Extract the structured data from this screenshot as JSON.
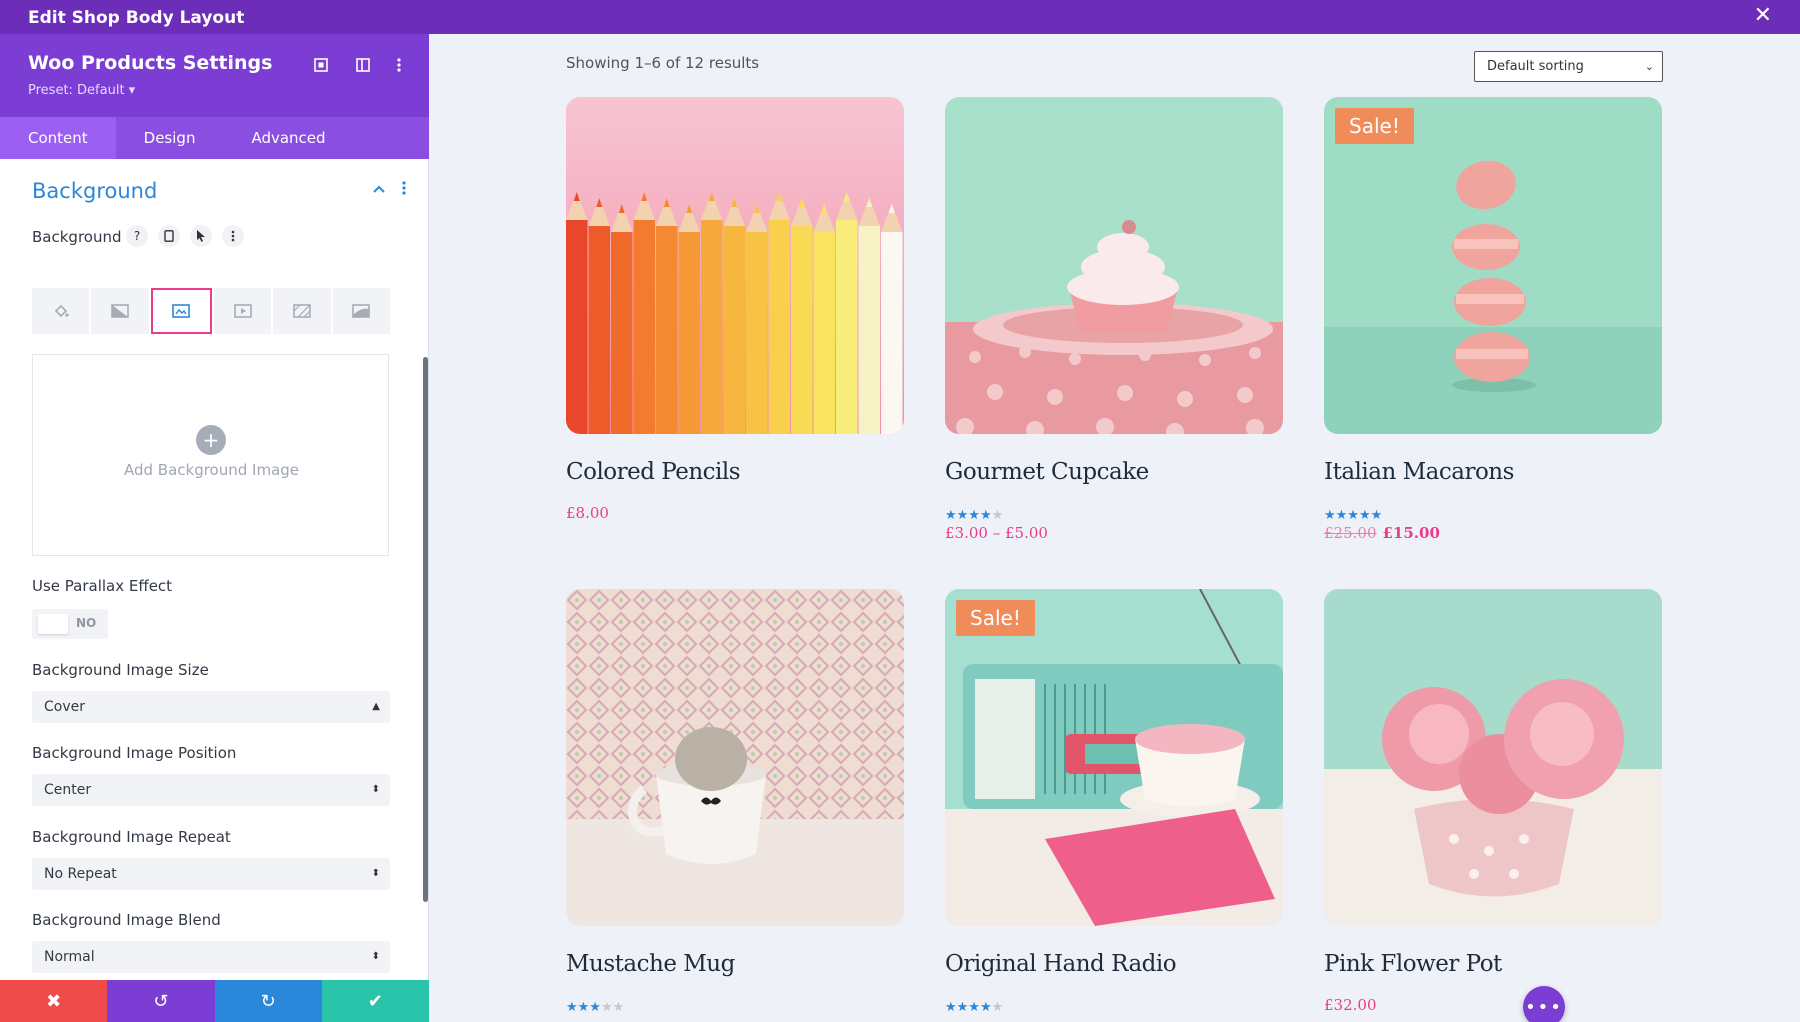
{
  "window": {
    "title": "Edit Shop Body Layout",
    "close_icon": "close-icon"
  },
  "sidebar": {
    "module_title": "Woo Products Settings",
    "preset": "Preset: Default ▾",
    "tabs": [
      {
        "label": "Content",
        "active": true
      },
      {
        "label": "Design",
        "active": false
      },
      {
        "label": "Advanced",
        "active": false
      }
    ],
    "section_title": "Background",
    "background_label": "Background",
    "background_help": "?",
    "upload_label": "Add Background Image",
    "parallax": {
      "label": "Use Parallax Effect",
      "value": "NO"
    },
    "fields": [
      {
        "label": "Background Image Size",
        "value": "Cover"
      },
      {
        "label": "Background Image Position",
        "value": "Center"
      },
      {
        "label": "Background Image Repeat",
        "value": "No Repeat"
      },
      {
        "label": "Background Image Blend",
        "value": "Normal"
      }
    ],
    "bottom_actions": [
      {
        "name": "discard",
        "icon": "✖",
        "color": "#ef4b4b"
      },
      {
        "name": "undo",
        "icon": "↺",
        "color": "#7b3dd4"
      },
      {
        "name": "redo",
        "icon": "↻",
        "color": "#2b87da"
      },
      {
        "name": "save",
        "icon": "✔",
        "color": "#29c4a9"
      }
    ]
  },
  "shop": {
    "results_text": "Showing 1–6 of 12 results",
    "sorting": "Default sorting",
    "products": [
      {
        "name": "Colored Pencils",
        "sale": false,
        "rating": null,
        "price": "£8.00",
        "old_price": null
      },
      {
        "name": "Gourmet Cupcake",
        "sale": false,
        "rating": 4,
        "price": "£3.00 – £5.00",
        "old_price": null
      },
      {
        "name": "Italian Macarons",
        "sale": true,
        "rating": 5,
        "price": "£15.00",
        "old_price": "£25.00"
      },
      {
        "name": "Mustache Mug",
        "sale": false,
        "rating": 3,
        "price": "",
        "old_price": null
      },
      {
        "name": "Original Hand Radio",
        "sale": true,
        "rating": 4,
        "price": "",
        "old_price": null
      },
      {
        "name": "Pink Flower Pot",
        "sale": false,
        "rating": null,
        "price": "£32.00",
        "old_price": null
      }
    ],
    "sale_label": "Sale!"
  },
  "colors": {
    "accent_purple": "#6c2eb9",
    "accent_blue": "#2b87da",
    "price_pink": "#e93c8b",
    "sale_orange": "#f08c5a"
  }
}
